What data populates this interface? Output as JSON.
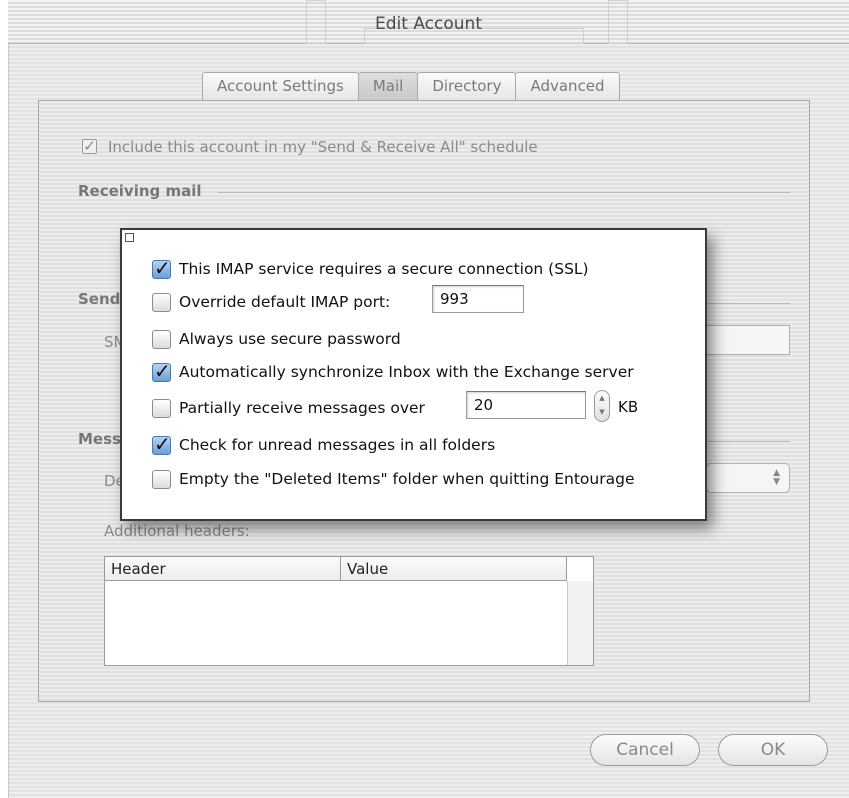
{
  "window": {
    "title": "Edit Account"
  },
  "tabs": [
    {
      "label": "Account Settings"
    },
    {
      "label": "Mail"
    },
    {
      "label": "Directory"
    },
    {
      "label": "Advanced"
    }
  ],
  "background": {
    "include_checkbox_label": "Include this account in my \"Send & Receive All\" schedule",
    "receiving_mail_heading": "Receiving mail",
    "send_heading_partial": "Send",
    "smtp_label_partial": "SM",
    "messages_heading_partial": "Mess",
    "default_label_partial": "De",
    "additional_headers_label": "Additional headers:",
    "table_headers": [
      "Header",
      "Value"
    ]
  },
  "popup": {
    "options": [
      {
        "label": "This IMAP service requires a secure connection (SSL)",
        "checked": true
      },
      {
        "label": "Override default IMAP port:",
        "checked": false
      },
      {
        "label": "Always use secure password",
        "checked": false
      },
      {
        "label": "Automatically synchronize Inbox with the Exchange server",
        "checked": true
      },
      {
        "label": "Partially receive messages over",
        "checked": false
      },
      {
        "label": "Check for unread messages in all folders",
        "checked": true
      },
      {
        "label": "Empty the \"Deleted Items\" folder when quitting Entourage",
        "checked": false
      }
    ],
    "imap_port_value": "993",
    "partial_size_value": "20",
    "partial_size_unit": "KB"
  },
  "buttons": {
    "cancel": "Cancel",
    "ok": "OK"
  },
  "icons": {
    "checkmark": "checkmark-icon",
    "stepper": "stepper-arrows-icon",
    "popup-arrows": "popup-arrows-icon"
  },
  "colors": {
    "checkbox_on": "#6d9fd8",
    "popup_border": "#3a3a3a"
  }
}
